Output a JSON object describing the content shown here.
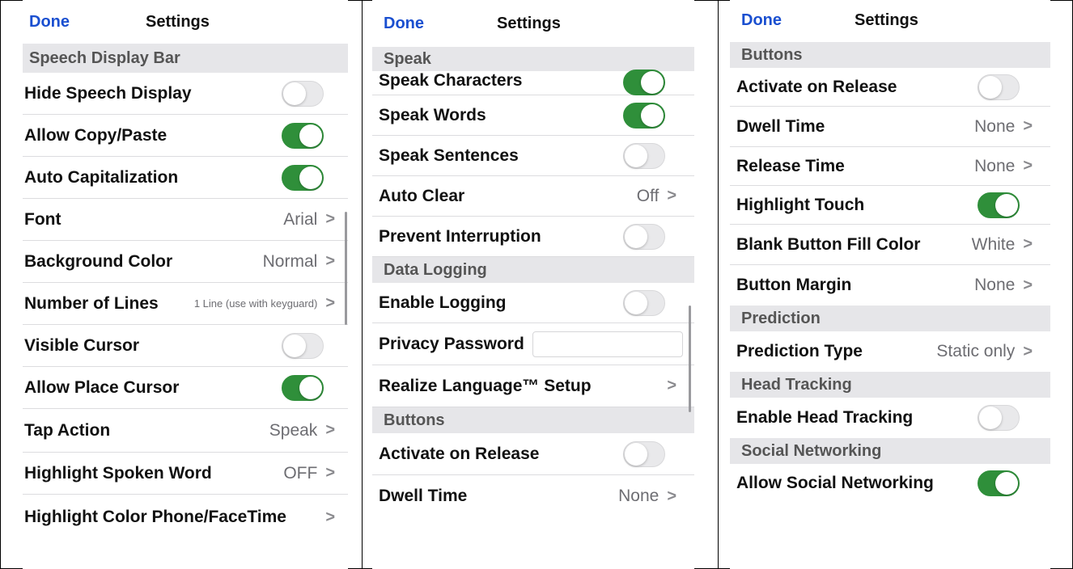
{
  "panel1": {
    "done": "Done",
    "title": "Settings",
    "section": "Speech Display Bar",
    "rows": {
      "hide_speech_display": "Hide Speech Display",
      "allow_copy_paste": "Allow Copy/Paste",
      "auto_capitalization": "Auto Capitalization",
      "font": "Font",
      "font_value": "Arial",
      "background_color": "Background Color",
      "background_color_value": "Normal",
      "number_of_lines": "Number of Lines",
      "number_of_lines_value": "1 Line (use with keyguard)",
      "visible_cursor": "Visible Cursor",
      "allow_place_cursor": "Allow Place Cursor",
      "tap_action": "Tap Action",
      "tap_action_value": "Speak",
      "highlight_spoken_word": "Highlight Spoken Word",
      "highlight_spoken_word_value": "OFF",
      "highlight_color": "Highlight Color Phone/FaceTime"
    },
    "toggles": {
      "hide_speech_display": false,
      "allow_copy_paste": true,
      "auto_capitalization": true,
      "visible_cursor": false,
      "allow_place_cursor": true
    }
  },
  "panel2": {
    "done": "Done",
    "title": "Settings",
    "sections": {
      "speak": "Speak",
      "data_logging": "Data Logging",
      "buttons": "Buttons"
    },
    "rows": {
      "speak_characters": "Speak Characters",
      "speak_words": "Speak Words",
      "speak_sentences": "Speak Sentences",
      "auto_clear": "Auto Clear",
      "auto_clear_value": "Off",
      "prevent_interruption": "Prevent Interruption",
      "enable_logging": "Enable Logging",
      "privacy_password": "Privacy Password",
      "realize_language": "Realize Language™ Setup",
      "activate_on_release": "Activate on Release",
      "dwell_time": "Dwell Time",
      "dwell_time_value": "None"
    },
    "toggles": {
      "speak_characters": true,
      "speak_words": true,
      "speak_sentences": false,
      "prevent_interruption": false,
      "enable_logging": false,
      "activate_on_release": false
    }
  },
  "panel3": {
    "done": "Done",
    "title": "Settings",
    "sections": {
      "buttons": "Buttons",
      "prediction": "Prediction",
      "head_tracking": "Head Tracking",
      "social_networking": "Social Networking"
    },
    "rows": {
      "activate_on_release": "Activate on Release",
      "dwell_time": "Dwell Time",
      "dwell_time_value": "None",
      "release_time": "Release Time",
      "release_time_value": "None",
      "highlight_touch": "Highlight Touch",
      "blank_button_fill_color": "Blank Button Fill Color",
      "blank_button_fill_color_value": "White",
      "button_margin": "Button Margin",
      "button_margin_value": "None",
      "prediction_type": "Prediction Type",
      "prediction_type_value": "Static only",
      "enable_head_tracking": "Enable Head Tracking",
      "allow_social_networking": "Allow Social Networking"
    },
    "toggles": {
      "activate_on_release": false,
      "highlight_touch": true,
      "enable_head_tracking": false,
      "allow_social_networking": true
    }
  },
  "icons": {
    "chevron": "chevron-right-icon"
  },
  "colors": {
    "accent": "#1a4fd0",
    "toggle_on": "#2f8f3a",
    "section_bg": "#e6e6e9"
  }
}
